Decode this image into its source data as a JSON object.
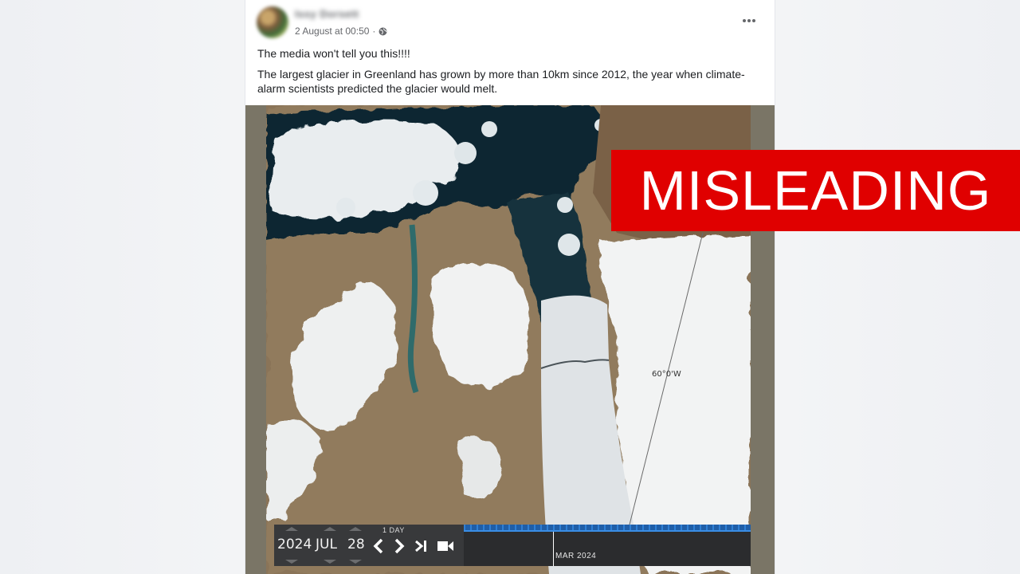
{
  "post": {
    "author": "Issy Dorsett",
    "timestamp": "2 August at 00:50",
    "audience_icon": "globe-icon",
    "more_icon": "more-options-icon",
    "text_line1": "The media won't tell you this!!!!",
    "text_line2": "The largest glacier in Greenland has grown by more than 10km since 2012, the year when climate-alarm scientists predicted the glacier would melt."
  },
  "image": {
    "longitude_label": "60°0'W",
    "timeline": {
      "year": "2024",
      "month": "JUL",
      "day": "28",
      "step": "1 DAY",
      "scale_label": "MAR 2024",
      "prev_icon": "chevron-left-icon",
      "next_icon": "chevron-right-icon",
      "end_icon": "skip-to-end-icon",
      "video_icon": "video-camera-icon"
    }
  },
  "overlay": {
    "label": "MISLEADING",
    "color": "#e00000"
  }
}
